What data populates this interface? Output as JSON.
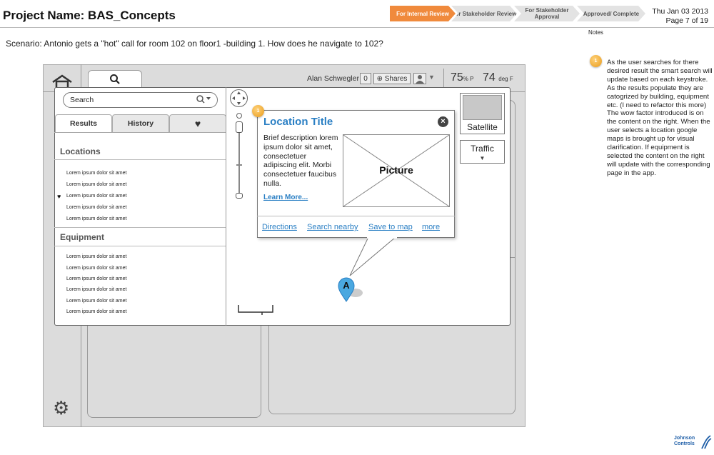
{
  "header": {
    "title": "Project Name: BAS_Concepts",
    "stages": [
      "For Internal Review",
      "For Stakeholder Review",
      "For Stakeholder Approval",
      "Approved/ Complete"
    ],
    "date": "Thu Jan 03 2013",
    "page": "Page 7 of 19",
    "notes_label": "Notes"
  },
  "scenario": "Scenario: Antonio gets a \"hot\" call for room 102 on floor1 -building 1. How does he navigate to 102?",
  "note": {
    "badge": "1",
    "text": "As the user searches for there desired result the smart search will update based on each keystroke. As the results populate they are catogrized by building, equipment etc. (I need to refactor this more) The wow factor introduced is on the content on the right. When the user selects a location google maps is brought up for visual clarification. If equipment is selected the content on the right will update with the corresponding page in the app."
  },
  "topbar": {
    "user": "Alan Schwegler",
    "count": "0",
    "shares": "Shares",
    "humidity": "75",
    "humidity_unit": "% P",
    "temperature": "74",
    "temperature_unit": "deg F"
  },
  "search": {
    "placeholder": "Search",
    "tabs": [
      "Results",
      "History"
    ],
    "sections": {
      "locations_title": "Locations",
      "locations": [
        "Lorem ipsum dolor sit amet",
        "Lorem ipsum dolor sit amet",
        "Lorem ipsum dolor sit amet",
        "Lorem ipsum dolor sit amet",
        "Lorem ipsum dolor sit amet"
      ],
      "equipment_title": "Equipment",
      "equipment": [
        "Lorem ipsum dolor sit amet",
        "Lorem ipsum dolor sit amet",
        "Lorem ipsum dolor sit amet",
        "Lorem ipsum dolor sit amet",
        "Lorem ipsum dolor sit amet",
        "Lorem ipsum dolor sit amet"
      ]
    }
  },
  "map": {
    "satellite": "Satellite",
    "traffic": "Traffic",
    "marker": "A"
  },
  "popup": {
    "badge": "1",
    "title": "Location Title",
    "description": "Brief description lorem ipsum dolor sit amet, consectetuer adipiscing elit. Morbi consectetuer faucibus nulla.",
    "learn_more": "Learn More...",
    "picture": "Picture",
    "links": [
      "Directions",
      "Search nearby",
      "Save to map",
      "more"
    ]
  },
  "logo": {
    "line1": "Johnson",
    "line2": "Controls"
  }
}
